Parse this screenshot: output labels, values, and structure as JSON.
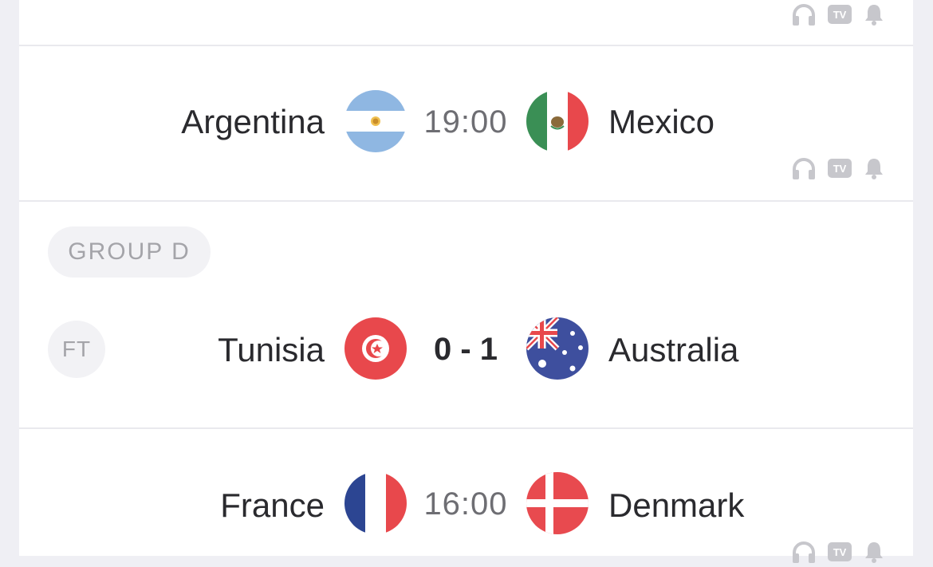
{
  "matches": [
    {
      "status": "",
      "home": "Argentina",
      "away": "Mexico",
      "center": "19:00"
    },
    {
      "group": "GROUP D",
      "status": "FT",
      "home": "Tunisia",
      "away": "Australia",
      "center": "0 - 1"
    },
    {
      "status": "",
      "home": "France",
      "away": "Denmark",
      "center": "16:00"
    }
  ],
  "icons": {
    "audio": "headphones-icon",
    "tv": "tv-icon",
    "tv_label": "TV",
    "alert": "bell-icon"
  },
  "colors": {
    "icon_gray": "#c7c7cc",
    "tunisia_red": "#e8484c",
    "denmark_red": "#e84a4f",
    "france_blue": "#2c4592",
    "mexico_green": "#3a8f55",
    "argentina_blue": "#8fb7e2",
    "australia_blue": "#3e4f9e"
  }
}
